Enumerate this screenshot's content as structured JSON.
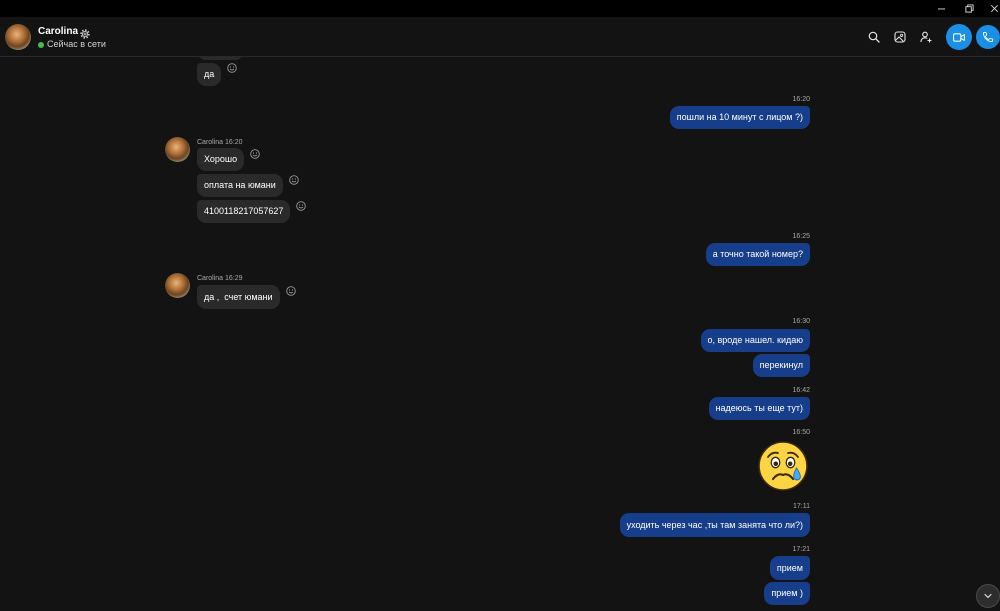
{
  "window_controls": {
    "minimize_icon": "minimize-icon",
    "restore_icon": "restore-icon",
    "close_icon": "close-icon"
  },
  "header": {
    "contact_name": "Carolina",
    "status_text": "Сейчас в сети",
    "icons": {
      "profile_settings": "gear-icon",
      "search": "search-icon",
      "gallery": "gallery-icon",
      "add_people": "add-person-icon",
      "video_call": "video-camera-icon",
      "audio_call": "phone-icon"
    }
  },
  "colors": {
    "background": "#131313",
    "divider": "#2a2a2a",
    "incoming_bubble": "#2a2a2a",
    "outgoing_bubble": "#173e8a",
    "call_button": "#1b8fe6",
    "online_status": "#3cc14a",
    "timestamp": "#a8a8a8"
  },
  "conversation": {
    "reaction_icon": "smiley-reaction-icon",
    "groups": [
      {
        "incoming": [
          "да"
        ]
      },
      {
        "time": "16:20",
        "outgoing": [
          "пошли на 10 минут с лицом ?)"
        ]
      },
      {
        "sender": "Carolina",
        "time": "16:20",
        "incoming": [
          "Хорошо",
          "оплата на юмани",
          "4100118217057627"
        ]
      },
      {
        "time": "16:25",
        "outgoing": [
          "а точно такой номер?"
        ]
      },
      {
        "sender": "Carolina",
        "time": "16:29",
        "incoming": [
          "да ,  счет юмани"
        ]
      },
      {
        "time": "16:30",
        "outgoing": [
          "о, вроде нашел. кидаю",
          "перекинул"
        ]
      },
      {
        "time": "16:42",
        "outgoing": [
          "надеюсь ты еще тут)"
        ]
      },
      {
        "time": "16:50",
        "outgoing_emoji": "sad-face-with-tear-emoji"
      },
      {
        "time": "17:11",
        "outgoing": [
          "уходить через час ,ты там занята что ли?)"
        ]
      },
      {
        "time": "17:21",
        "outgoing": [
          "прием",
          "прием )"
        ]
      }
    ]
  },
  "scroll_to_bottom": {
    "icon": "chevron-down-icon"
  }
}
